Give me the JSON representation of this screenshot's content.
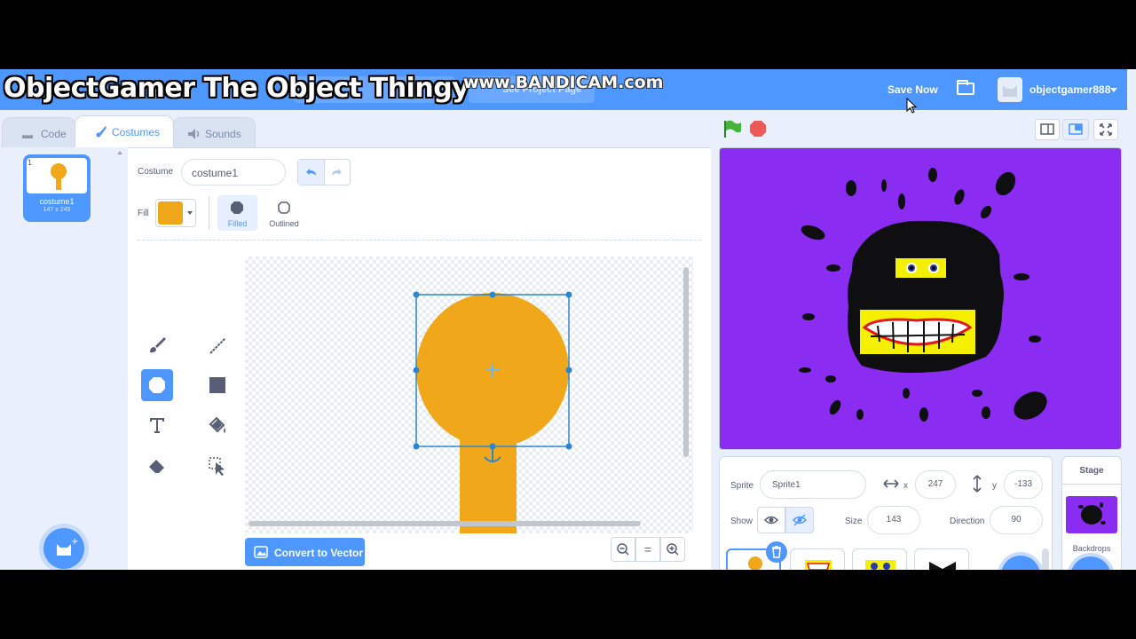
{
  "overlay": {
    "channel_title": "ObjectGamer The Object Thingy",
    "recorder_watermark": "www.BANDICAM.com"
  },
  "menubar": {
    "see_project_page": "See Project Page",
    "save_now": "Save Now",
    "folder_icon": "folder-icon",
    "username": "objectgamer888"
  },
  "tabs": [
    {
      "label": "Code",
      "icon": "code-icon"
    },
    {
      "label": "Costumes",
      "icon": "brush-icon"
    },
    {
      "label": "Sounds",
      "icon": "speaker-icon"
    }
  ],
  "costume_list": [
    {
      "index": "1",
      "name": "costume1",
      "size": "147 x 245"
    }
  ],
  "editor": {
    "costume_label": "Costume",
    "costume_name": "costume1",
    "fill_label": "Fill",
    "fill_color": "#f0a81a",
    "filled_label": "Filled",
    "outlined_label": "Outlined",
    "convert_button": "Convert to Vector",
    "zoom_out": "−",
    "zoom_reset": "=",
    "zoom_in": "+"
  },
  "stage_controls": {
    "green_flag": "green-flag-icon",
    "stop": "stop-icon"
  },
  "sprite_info": {
    "sprite_label": "Sprite",
    "sprite_name": "Sprite1",
    "x_label": "x",
    "x_value": "247",
    "y_label": "y",
    "y_value": "-133",
    "show_label": "Show",
    "size_label": "Size",
    "size_value": "143",
    "direction_label": "Direction",
    "direction_value": "90"
  },
  "stage_panel": {
    "title": "Stage",
    "backdrops_label": "Backdrops"
  },
  "colors": {
    "brand_blue": "#4d97ff",
    "stage_bg": "#8a2cf2",
    "costume_orange": "#f0a81a"
  }
}
